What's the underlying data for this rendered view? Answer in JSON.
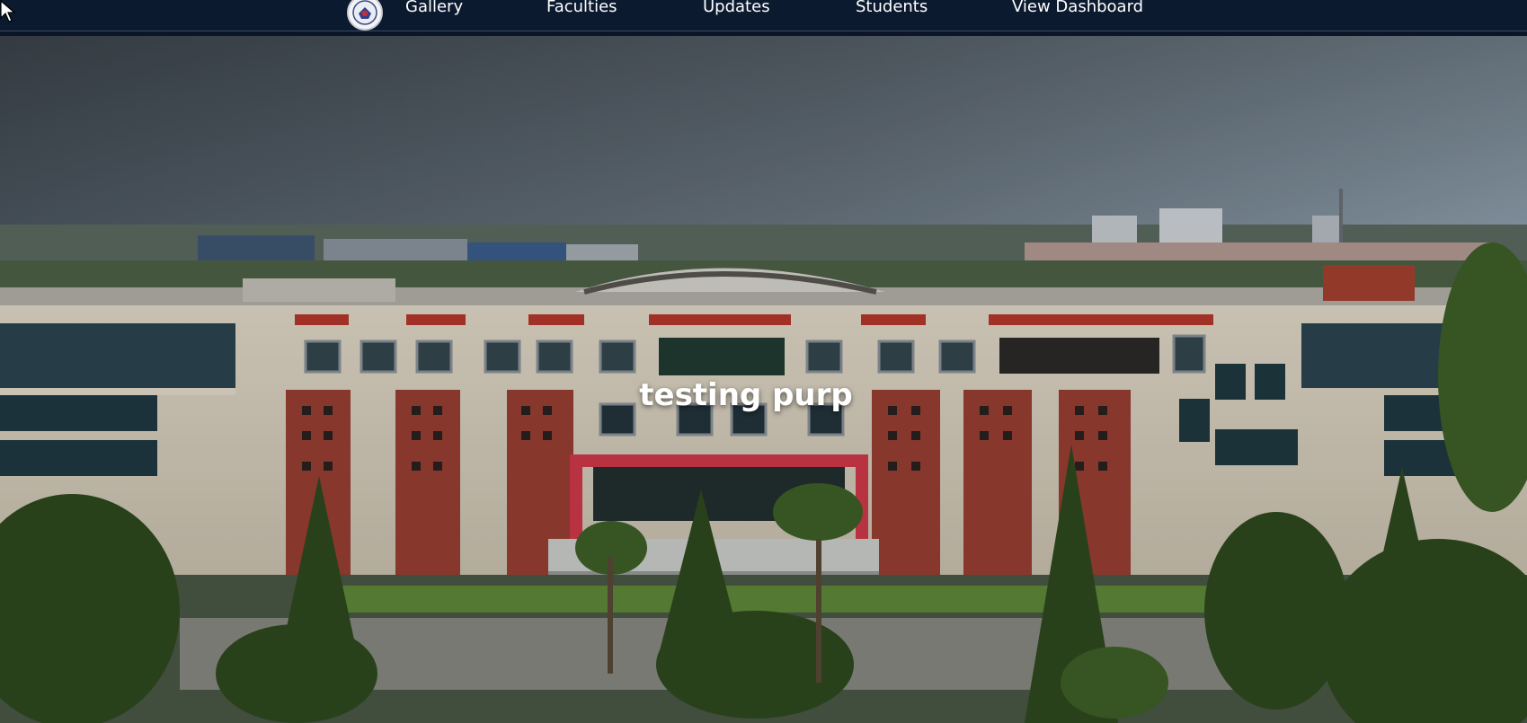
{
  "nav": {
    "items": [
      {
        "label": "Gallery"
      },
      {
        "label": "Faculties"
      },
      {
        "label": "Updates"
      },
      {
        "label": "Students"
      },
      {
        "label": "View Dashboard"
      }
    ]
  },
  "hero": {
    "caption": "testing purp"
  },
  "colors": {
    "navbar_bg": "#0b1a2e",
    "brick": "#9a3f33",
    "accent_red": "#c2332c",
    "sky": "#7d8d99"
  }
}
